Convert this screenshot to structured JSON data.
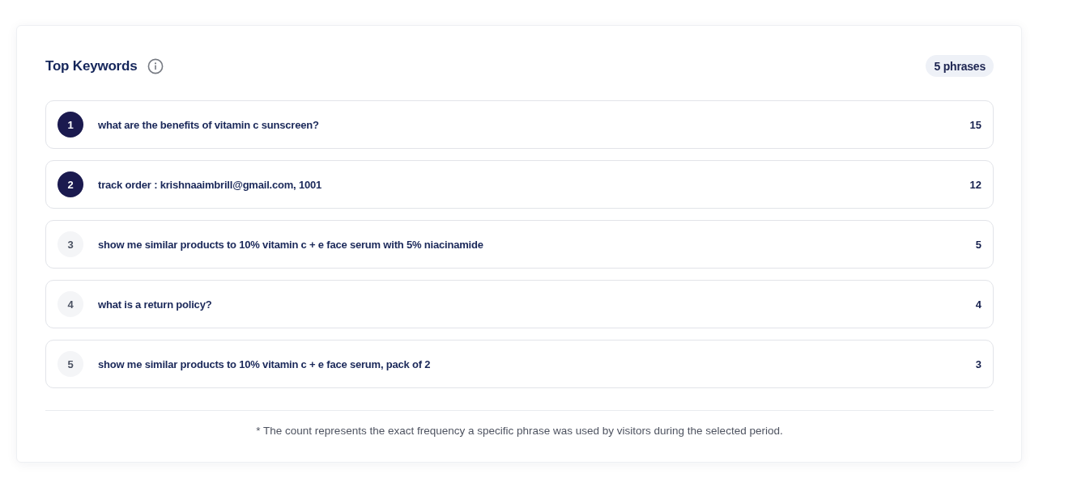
{
  "card": {
    "title": "Top Keywords",
    "badge": "5 phrases",
    "footnote": "* The count represents the exact frequency a specific phrase was used by visitors during the selected period."
  },
  "keywords": [
    {
      "rank": "1",
      "phrase": "what are the benefits of vitamin c sunscreen?",
      "count": "15",
      "highlighted": true
    },
    {
      "rank": "2",
      "phrase": "track order : krishnaaimbrill@gmail.com, 1001",
      "count": "12",
      "highlighted": true
    },
    {
      "rank": "3",
      "phrase": "show me similar products to 10% vitamin c + e face serum with 5% niacinamide",
      "count": "5",
      "highlighted": false
    },
    {
      "rank": "4",
      "phrase": "what is a return policy?",
      "count": "4",
      "highlighted": false
    },
    {
      "rank": "5",
      "phrase": "show me similar products to 10% vitamin c + e face serum, pack of 2",
      "count": "3",
      "highlighted": false
    }
  ]
}
